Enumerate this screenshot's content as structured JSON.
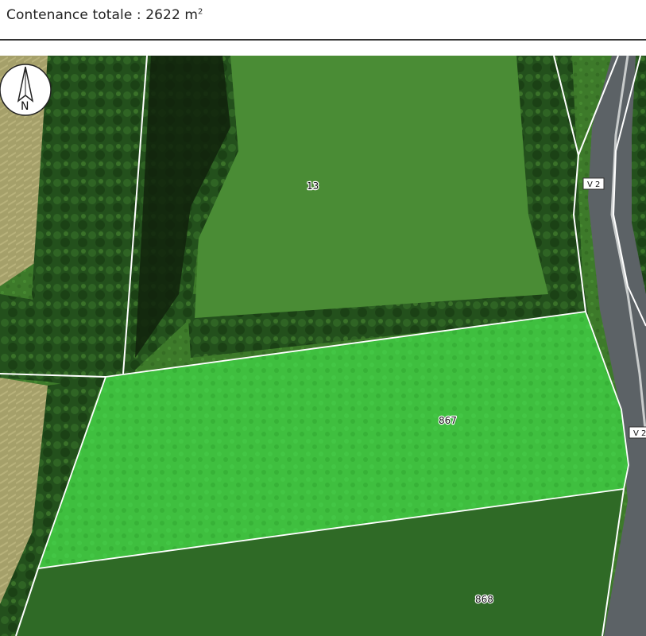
{
  "header": {
    "label": "Contenance totale : 2622 m",
    "unit_exponent": "2"
  },
  "map": {
    "north_arrow": {
      "letter": "N"
    },
    "parcels": [
      {
        "id": "13",
        "label": "13",
        "selected": false
      },
      {
        "id": "867",
        "label": "867",
        "selected": true
      },
      {
        "id": "868",
        "label": "868",
        "selected": false
      }
    ],
    "road_labels": [
      {
        "label": "V 2"
      },
      {
        "label": "V 2"
      }
    ],
    "colors": {
      "selected_parcel": "#3fbf3f",
      "parcel_boundary": "#ffffff",
      "road": "#5c6266"
    }
  }
}
